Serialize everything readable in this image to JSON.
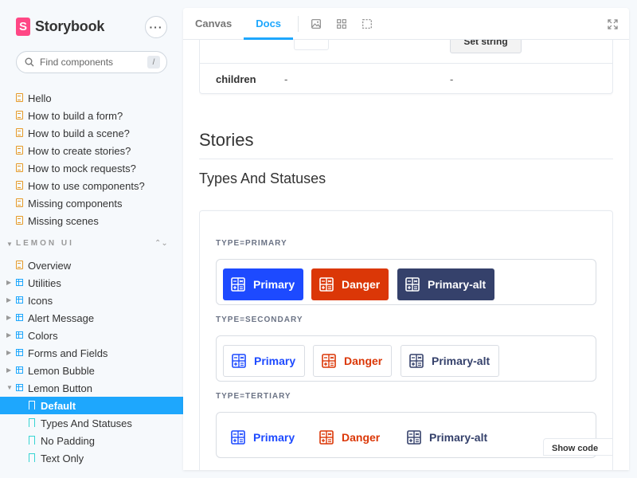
{
  "brand": {
    "name": "Storybook",
    "logo_letter": "S"
  },
  "search": {
    "placeholder": "Find components",
    "shortcut": "/"
  },
  "sidebar": {
    "docs": [
      "Hello",
      "How to build a form?",
      "How to build a scene?",
      "How to create stories?",
      "How to mock requests?",
      "How to use components?",
      "Missing components",
      "Missing scenes"
    ],
    "section": {
      "title": "LEMON UI"
    },
    "overview": "Overview",
    "components": [
      "Utilities",
      "Icons",
      "Alert Message",
      "Colors",
      "Forms and Fields",
      "Lemon Bubble"
    ],
    "expanded_component": "Lemon Button",
    "stories": [
      {
        "label": "Default",
        "selected": true
      },
      {
        "label": "Types And Statuses",
        "selected": false
      },
      {
        "label": "No Padding",
        "selected": false
      },
      {
        "label": "Text Only",
        "selected": false
      }
    ]
  },
  "toolbar": {
    "tabs": [
      "Canvas",
      "Docs"
    ],
    "active_tab": "Docs"
  },
  "args_table": {
    "set_string_label": "Set string",
    "row": {
      "name": "children",
      "description": "-",
      "default": "-"
    }
  },
  "docs": {
    "stories_heading": "Stories",
    "story_heading": "Types And Statuses",
    "groups": [
      {
        "label": "TYPE=PRIMARY",
        "buttons": [
          "Primary",
          "Danger",
          "Primary-alt"
        ]
      },
      {
        "label": "TYPE=SECONDARY",
        "buttons": [
          "Primary",
          "Danger",
          "Primary-alt"
        ]
      },
      {
        "label": "TYPE=TERTIARY",
        "buttons": [
          "Primary",
          "Danger",
          "Primary-alt"
        ]
      }
    ],
    "show_code": "Show code"
  },
  "colors": {
    "accent": "#1ea7fd",
    "primary": "#1d4aff",
    "danger": "#db3707",
    "primary_alt": "#35416b",
    "brand": "#ff4785"
  },
  "icons": {
    "doc": "document-icon",
    "component": "component-icon",
    "story": "bookmark-icon",
    "button": "calculator-icon"
  }
}
